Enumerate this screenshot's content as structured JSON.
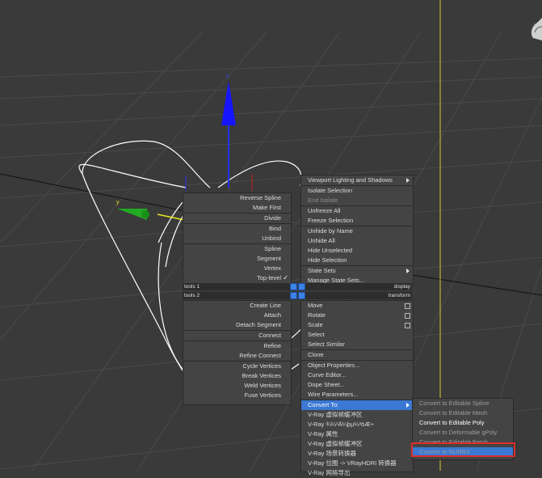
{
  "viewport": {
    "axis_z": "z",
    "axis_y": "y"
  },
  "quad_left": {
    "items": [
      {
        "label": "Reverse Spline"
      },
      {
        "label": "Make First"
      },
      {
        "label": "Divide"
      },
      {
        "label": "Bind"
      },
      {
        "label": "Unbind"
      },
      {
        "label": "Spline"
      },
      {
        "label": "Segment"
      },
      {
        "label": "Vertex"
      },
      {
        "label": "Top-level",
        "checked": true
      }
    ],
    "items2": [
      {
        "label": "Create Line"
      },
      {
        "label": "Attach"
      },
      {
        "label": "Detach Segment"
      },
      {
        "label": "Connect"
      },
      {
        "label": "Refine"
      },
      {
        "label": "Refine Connect"
      },
      {
        "label": "Cycle Vertices"
      },
      {
        "label": "Break Vertices"
      },
      {
        "label": "Weld Vertices"
      },
      {
        "label": "Fuse Vertices"
      }
    ]
  },
  "quad_right": {
    "items": [
      {
        "label": "Viewport Lighting and Shadows",
        "submenu": true
      },
      {
        "label": "Isolate Selection"
      },
      {
        "label": "End Isolate",
        "disabled": true
      },
      {
        "label": "Unfreeze All"
      },
      {
        "label": "Freeze Selection"
      },
      {
        "label": "Unhide by Name"
      },
      {
        "label": "Unhide All"
      },
      {
        "label": "Hide Unselected"
      },
      {
        "label": "Hide Selection"
      },
      {
        "label": "State Sets",
        "submenu": true
      },
      {
        "label": "Manage State Sets..."
      }
    ],
    "items2": [
      {
        "label": "Move"
      },
      {
        "label": "Rotate"
      },
      {
        "label": "Scale"
      },
      {
        "label": "Select"
      },
      {
        "label": "Select Similar"
      },
      {
        "label": "Clone"
      },
      {
        "label": "Object Properties..."
      },
      {
        "label": "Curve Editor..."
      },
      {
        "label": "Dope Sheet..."
      },
      {
        "label": "Wire Parameters..."
      },
      {
        "label": "Convert To:",
        "submenu": true,
        "highlighted": true
      },
      {
        "label": "V-Ray 虚拟帧缓冲区"
      },
      {
        "label": "V-Ray ¾¼¹Ä¼þµ¼³öÆ÷"
      },
      {
        "label": "V-Ray 属性"
      },
      {
        "label": "V-Ray 虚拟帧缓冲区"
      },
      {
        "label": "V-Ray 场景转换器"
      },
      {
        "label": "V-Ray 位图 -> VRayHDRI 转换器"
      },
      {
        "label": "V-Ray 网格导出"
      }
    ]
  },
  "bands": {
    "tools1": "tools 1",
    "display": "display",
    "tools2": "tools 2",
    "transform": "transform"
  },
  "convert_submenu": [
    {
      "label": "Convert to Editable Spline",
      "enabled": false
    },
    {
      "label": "Convert to Editable Mesh",
      "enabled": false
    },
    {
      "label": "Convert to Editable Poly",
      "enabled": true
    },
    {
      "label": "Convert to Deformable gPoly",
      "enabled": false
    },
    {
      "label": "Convert to Editable Patch",
      "enabled": false
    },
    {
      "label": "Convert to NURBS",
      "enabled": true,
      "highlighted": true
    }
  ],
  "colors": {
    "highlight": "#3a78d4",
    "annotation": "#d9302c",
    "axis_z": "#1010e0",
    "axis_y": "#18a018",
    "spline": "#ffffff"
  }
}
